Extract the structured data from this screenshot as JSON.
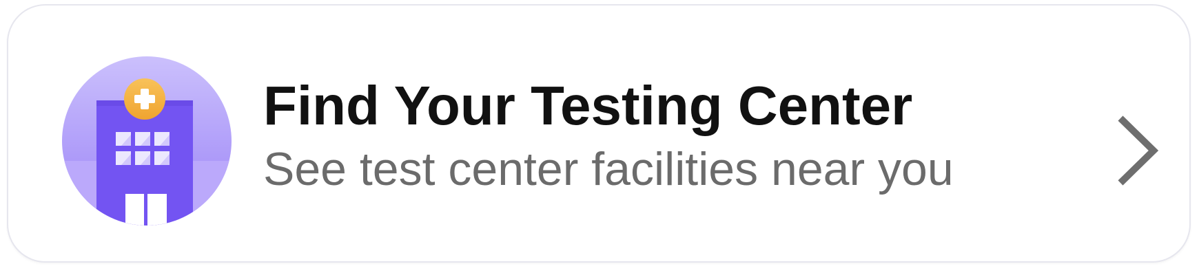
{
  "card": {
    "title": "Find Your Testing Center",
    "subtitle": "See test center facilities near you",
    "icon": "hospital-building-icon",
    "action_icon": "chevron-right-icon"
  },
  "colors": {
    "title": "#111111",
    "subtitle": "#6b6b6b",
    "chevron": "#6e6e6e",
    "circle_light": "#c4b8fb",
    "building": "#7658f3",
    "medical_badge": "#f5b13f",
    "border": "#e6e6ee"
  }
}
